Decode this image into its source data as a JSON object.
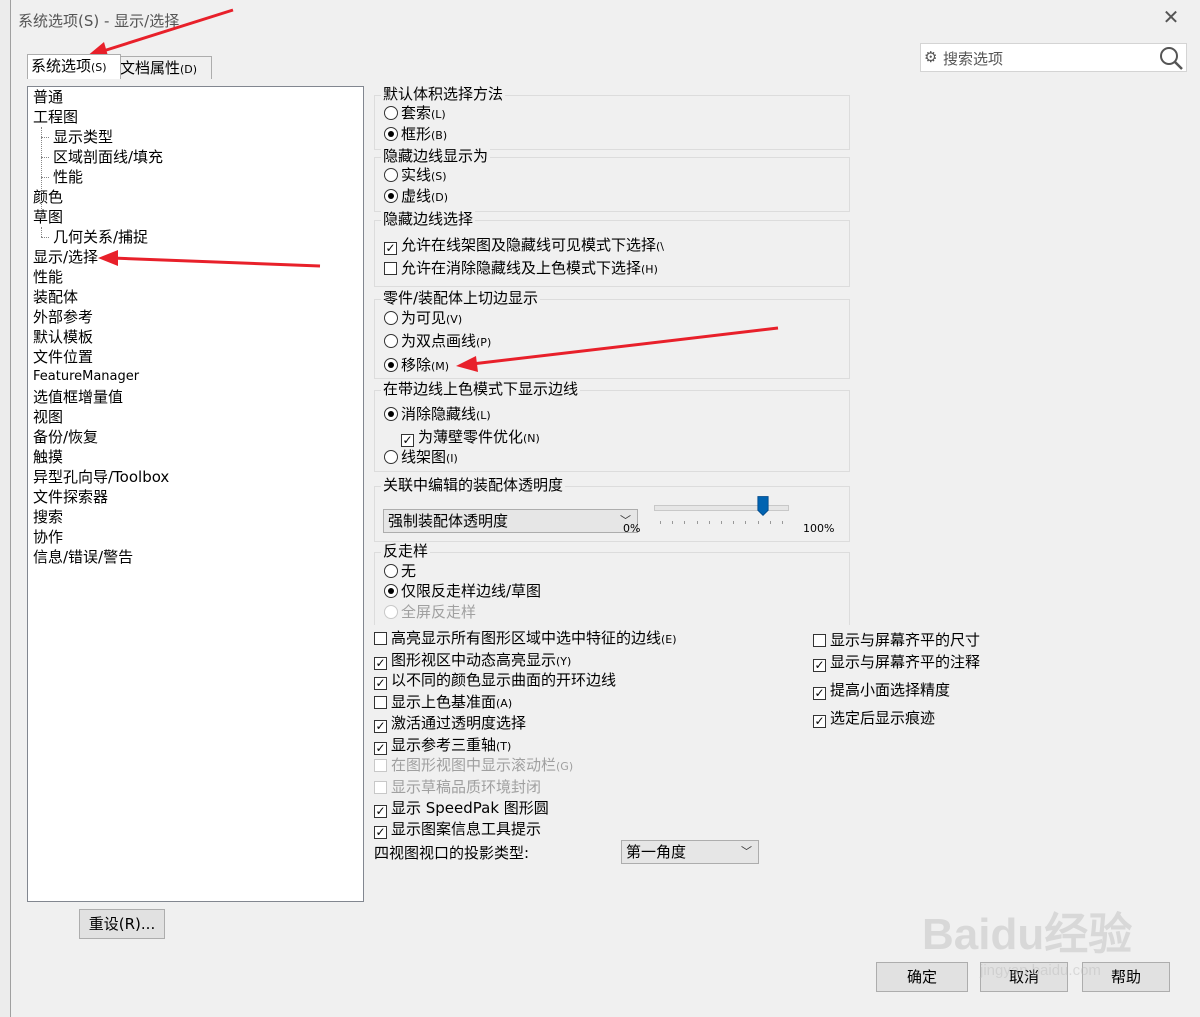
{
  "window": {
    "title": "系统选项(S) - 显示/选择",
    "close_glyph": "✕"
  },
  "tabs": [
    {
      "label": "系统选项",
      "accel": "(S)"
    },
    {
      "label": "文档属性",
      "accel": "(D)"
    }
  ],
  "search": {
    "placeholder": "搜索选项"
  },
  "tree": [
    {
      "label": "普通"
    },
    {
      "label": "工程图"
    },
    {
      "label": "显示类型",
      "child": true
    },
    {
      "label": "区域剖面线/填充",
      "child": true
    },
    {
      "label": "性能",
      "child": true
    },
    {
      "label": "颜色"
    },
    {
      "label": "草图"
    },
    {
      "label": "几何关系/捕捉",
      "child": true
    },
    {
      "label": "显示/选择",
      "selected": true
    },
    {
      "label": "性能"
    },
    {
      "label": "装配体"
    },
    {
      "label": "外部参考"
    },
    {
      "label": "默认模板"
    },
    {
      "label": "文件位置"
    },
    {
      "label": "FeatureManager"
    },
    {
      "label": "选值框增量值"
    },
    {
      "label": "视图"
    },
    {
      "label": "备份/恢复"
    },
    {
      "label": "触摸"
    },
    {
      "label": "异型孔向导/Toolbox"
    },
    {
      "label": "文件探索器"
    },
    {
      "label": "搜索"
    },
    {
      "label": "协作"
    },
    {
      "label": "信息/错误/警告"
    }
  ],
  "reset_button": "重设(R)...",
  "groups": {
    "volume_select": {
      "title": "默认体积选择方法",
      "options": [
        {
          "label": "套索",
          "accel": "(L)",
          "checked": false
        },
        {
          "label": "框形",
          "accel": "(B)",
          "checked": true
        }
      ]
    },
    "hidden_edges_display": {
      "title": "隐藏边线显示为",
      "options": [
        {
          "label": "实线",
          "accel": "(S)",
          "checked": false
        },
        {
          "label": "虚线",
          "accel": "(D)",
          "checked": true
        }
      ]
    },
    "hidden_edges_select": {
      "title": "隐藏边线选择",
      "options": [
        {
          "label": "允许在线架图及隐藏线可见模式下选择",
          "accel": "(\\",
          "checked": true
        },
        {
          "label": "允许在消除隐藏线及上色模式下选择",
          "accel": "(H)",
          "checked": false
        }
      ]
    },
    "tangent_edges": {
      "title": "零件/装配体上切边显示",
      "options": [
        {
          "label": "为可见",
          "accel": "(V)",
          "checked": false
        },
        {
          "label": "为双点画线",
          "accel": "(P)",
          "checked": false
        },
        {
          "label": "移除",
          "accel": "(M)",
          "checked": true
        }
      ]
    },
    "shaded_edges": {
      "title": "在带边线上色模式下显示边线",
      "options": [
        {
          "label": "消除隐藏线",
          "accel": "(L)",
          "checked": true
        },
        {
          "label": "为薄壁零件优化",
          "accel": "(N)",
          "checked": true
        },
        {
          "label": "线架图",
          "accel": "(I)",
          "checked": false
        }
      ]
    },
    "transparency": {
      "title": "关联中编辑的装配体透明度",
      "combo": "强制装配体透明度",
      "slider_min": "0%",
      "slider_max": "100%",
      "slider_value": 0.85
    },
    "antialias": {
      "title": "反走样",
      "options": [
        {
          "label": "无",
          "checked": false
        },
        {
          "label": "仅限反走样边线/草图",
          "checked": true
        },
        {
          "label": "全屏反走样",
          "checked": false,
          "disabled": true
        }
      ]
    }
  },
  "checks_left": [
    {
      "label": "高亮显示所有图形区域中选中特征的边线",
      "accel": "(E)",
      "checked": false
    },
    {
      "label": "图形视区中动态高亮显示",
      "accel": "(Y)",
      "checked": true
    },
    {
      "label": "以不同的颜色显示曲面的开环边线",
      "accel": "",
      "checked": true
    },
    {
      "label": "显示上色基准面",
      "accel": "(A)",
      "checked": false
    },
    {
      "label": "激活通过透明度选择",
      "accel": "",
      "checked": true
    },
    {
      "label": "显示参考三重轴",
      "accel": "(T)",
      "checked": true
    },
    {
      "label": "在图形视图中显示滚动栏",
      "accel": "(G)",
      "checked": false,
      "disabled": true
    },
    {
      "label": "显示草稿品质环境封闭",
      "accel": "",
      "checked": false,
      "disabled": true
    },
    {
      "label": "显示 SpeedPak 图形圆",
      "accel": "",
      "checked": true
    },
    {
      "label": "显示图案信息工具提示",
      "accel": "",
      "checked": true
    }
  ],
  "checks_right": [
    {
      "label": "显示与屏幕齐平的尺寸",
      "checked": false
    },
    {
      "label": "显示与屏幕齐平的注释",
      "checked": true
    },
    {
      "label": "提高小面选择精度",
      "checked": true
    },
    {
      "label": "选定后显示痕迹",
      "checked": true
    }
  ],
  "projection": {
    "label": "四视图视口的投影类型:",
    "value": "第一角度"
  },
  "footer": {
    "ok": "确定",
    "cancel": "取消",
    "help": "帮助"
  },
  "watermark": {
    "text": "Baidu经验",
    "sub": "jingyan.baidu.com"
  },
  "colors": {
    "arrow": "#e8202a",
    "tree_border": "#828790"
  }
}
